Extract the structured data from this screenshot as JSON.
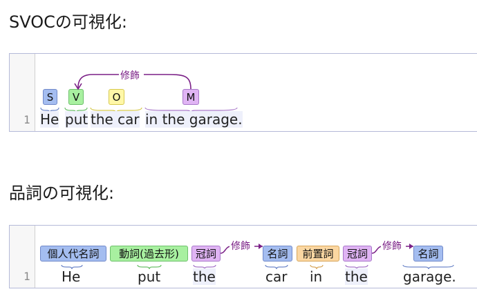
{
  "section1": {
    "heading": "SVOCの可視化:",
    "line_number": "1",
    "tags": [
      "S",
      "V",
      "O",
      "M"
    ],
    "words": [
      "He",
      "put",
      "the car",
      "in the garage."
    ],
    "arc_label": "修飾"
  },
  "section2": {
    "heading": "品詞の可視化:",
    "line_number": "1",
    "tags": [
      "個人代名詞",
      "動詞(過去形)",
      "冠詞",
      "名詞",
      "前置詞",
      "冠詞",
      "名詞"
    ],
    "words": [
      "He",
      "put",
      "the",
      "car",
      "in",
      "the",
      "garage."
    ],
    "arc_label": "修飾"
  },
  "colors": {
    "subject": "#a4bdf0",
    "verb": "#a8f0a0",
    "object": "#fff7a8",
    "modifier": "#e0b4f4",
    "preposition": "#fbd7a2",
    "arc": "#7a1f86"
  }
}
